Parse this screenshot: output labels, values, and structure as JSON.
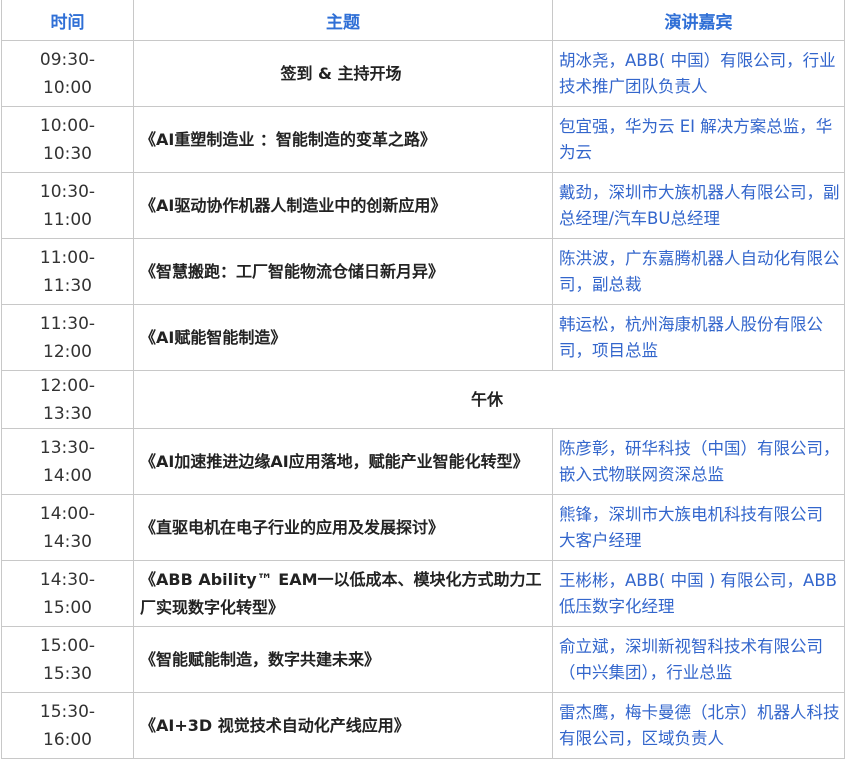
{
  "headers": {
    "time": "时间",
    "topic": "主题",
    "speaker": "演讲嘉宾"
  },
  "rows": [
    {
      "start": "09:30-",
      "end": "10:00",
      "topic": "签到 & 主持开场",
      "speaker": "胡冰尧，ABB( 中国）有限公司，行业技术推广团队负责人"
    },
    {
      "start": "10:00-",
      "end": "10:30",
      "topic": "《AI重塑制造业 ：智能制造的变革之路》",
      "speaker": "包宜强，华为云 EI 解决方案总监，华为云"
    },
    {
      "start": "10:30-",
      "end": "11:00",
      "topic": "《AI驱动协作机器人制造业中的创新应用》",
      "speaker": "戴劲，深圳市大族机器人有限公司，副总经理/汽车BU总经理"
    },
    {
      "start": "11:00-",
      "end": "11:30",
      "topic": "《智慧搬跑：工厂智能物流仓储日新月异》",
      "speaker": "陈洪波，广东嘉腾机器人自动化有限公司，副总裁"
    },
    {
      "start": "11:30-",
      "end": "12:00",
      "topic": "《AI赋能智能制造》",
      "speaker": "韩运松，杭州海康机器人股份有限公司，项目总监"
    },
    {
      "start": "12:00-",
      "end": "13:30",
      "topic": "午休",
      "speaker": ""
    },
    {
      "start": "13:30-",
      "end": "14:00",
      "topic": "《AI加速推进边缘AI应用落地，赋能产业智能化转型》",
      "speaker": "陈彦彰，研华科技（中国）有限公司，嵌入式物联网资深总监"
    },
    {
      "start": "14:00-",
      "end": "14:30",
      "topic": "《直驱电机在电子行业的应用及发展探讨》",
      "speaker": "熊锋，深圳市大族电机科技有限公司 大客户经理"
    },
    {
      "start": "14:30-",
      "end": "15:00",
      "topic": "《ABB Ability™ EAM一以低成本、模块化方式助力工厂实现数字化转型》",
      "speaker": "王彬彬，ABB( 中国 ) 有限公司，ABB低压数字化经理"
    },
    {
      "start": "15:00-",
      "end": "15:30",
      "topic": "《智能赋能制造，数字共建未来》",
      "speaker": "俞立斌，深圳新视智科技术有限公司（中兴集团），行业总监"
    },
    {
      "start": "15:30-",
      "end": "16:00",
      "topic": "《AI+3D 视觉技术自动化产线应用》",
      "speaker": "雷杰鹰，梅卡曼德（北京）机器人科技有限公司，区域负责人"
    }
  ]
}
